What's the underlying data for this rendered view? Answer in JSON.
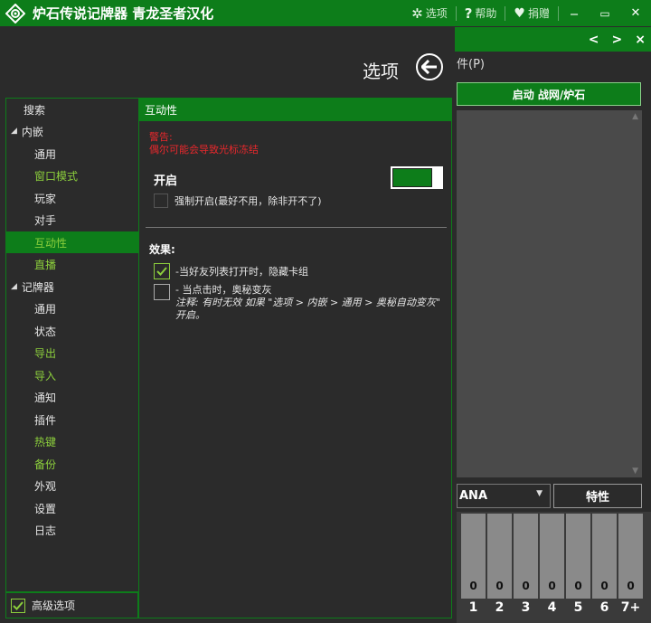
{
  "titlebar": {
    "app_title": "炉石传说记牌器 青龙圣者汉化",
    "options_label": "选项",
    "help_label": "帮助",
    "donate_label": "捐赠",
    "minimize_glyph": "‒",
    "maximize_glyph": "▭",
    "close_glyph": "✕"
  },
  "background_window": {
    "nav": {
      "prev": "<",
      "next": ">",
      "close": "×"
    },
    "menu_text": "件(P)",
    "launch_button": "启动 战网/炉石",
    "mana_select": "ANA",
    "attr_button": "特性",
    "mana_curve": {
      "labels": [
        "1",
        "2",
        "3",
        "4",
        "5",
        "6",
        "7+"
      ],
      "counts": [
        0,
        0,
        0,
        0,
        0,
        0,
        0
      ]
    }
  },
  "options": {
    "title": "选项",
    "sidebar": {
      "search": "搜索",
      "embedded": "内嵌",
      "general": "通用",
      "window_mode": "窗口模式",
      "player": "玩家",
      "opponent": "对手",
      "interactivity": "互动性",
      "streaming": "直播",
      "tracker": "记牌器",
      "tracker_general": "通用",
      "status": "状态",
      "export": "导出",
      "import": "导入",
      "notifications": "通知",
      "plugins": "插件",
      "hotkeys": "热键",
      "backup": "备份",
      "appearance": "外观",
      "settings": "设置",
      "log": "日志"
    },
    "advanced_label": "高级选项",
    "advanced_checked": true,
    "panel": {
      "header": "互动性",
      "warning_title": "警告:",
      "warning_text": "偶尔可能会导致光标冻结",
      "enable_label": "开启",
      "enable_on": true,
      "force_label": "强制开启(最好不用，除非开不了)",
      "effects_label": "效果:",
      "effect1": "-当好友列表打开时，隐藏卡组",
      "effect1_checked": true,
      "effect2": "- 当点击时，奥秘变灰",
      "effect2_note": "注释: 有时无效 如果 \"选项 > 内嵌 > 通用 > 奥秘自动变灰\" 开启。",
      "effect2_checked": false
    }
  }
}
